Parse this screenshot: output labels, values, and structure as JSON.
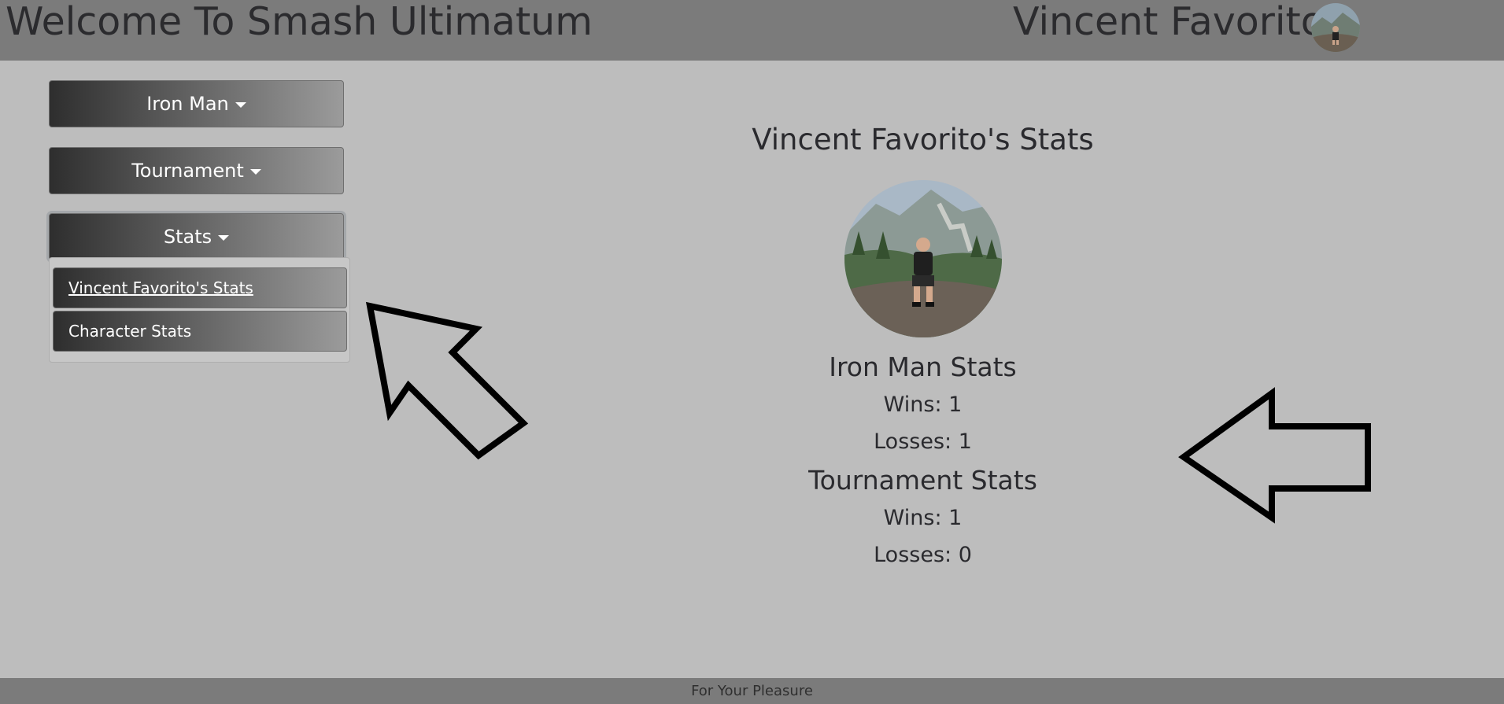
{
  "header": {
    "title": "Welcome To Smash Ultimatum",
    "user_name": "Vincent Favorito",
    "avatar_icon": "user-photo-icon"
  },
  "sidebar": {
    "buttons": [
      {
        "label": "Iron Man"
      },
      {
        "label": "Tournament"
      },
      {
        "label": "Stats"
      }
    ],
    "stats_dropdown": {
      "items": [
        {
          "label": "Vincent Favorito's Stats"
        },
        {
          "label": "Character Stats"
        }
      ]
    }
  },
  "main": {
    "title": "Vincent Favorito's Stats",
    "sections": [
      {
        "heading": "Iron Man Stats",
        "wins": "Wins: 1",
        "losses": "Losses: 1"
      },
      {
        "heading": "Tournament Stats",
        "wins": "Wins: 1",
        "losses": "Losses: 0"
      }
    ]
  },
  "annotations": {
    "arrow_icons": [
      "arrow-up-left-icon",
      "arrow-left-icon"
    ]
  },
  "footer": {
    "text": "For Your Pleasure"
  },
  "colors": {
    "background": "#bdbdbd",
    "bar": "#7b7b7b",
    "text": "#2a2a2e",
    "button_start": "#2e2e2e",
    "button_end": "#9b9b9b"
  }
}
